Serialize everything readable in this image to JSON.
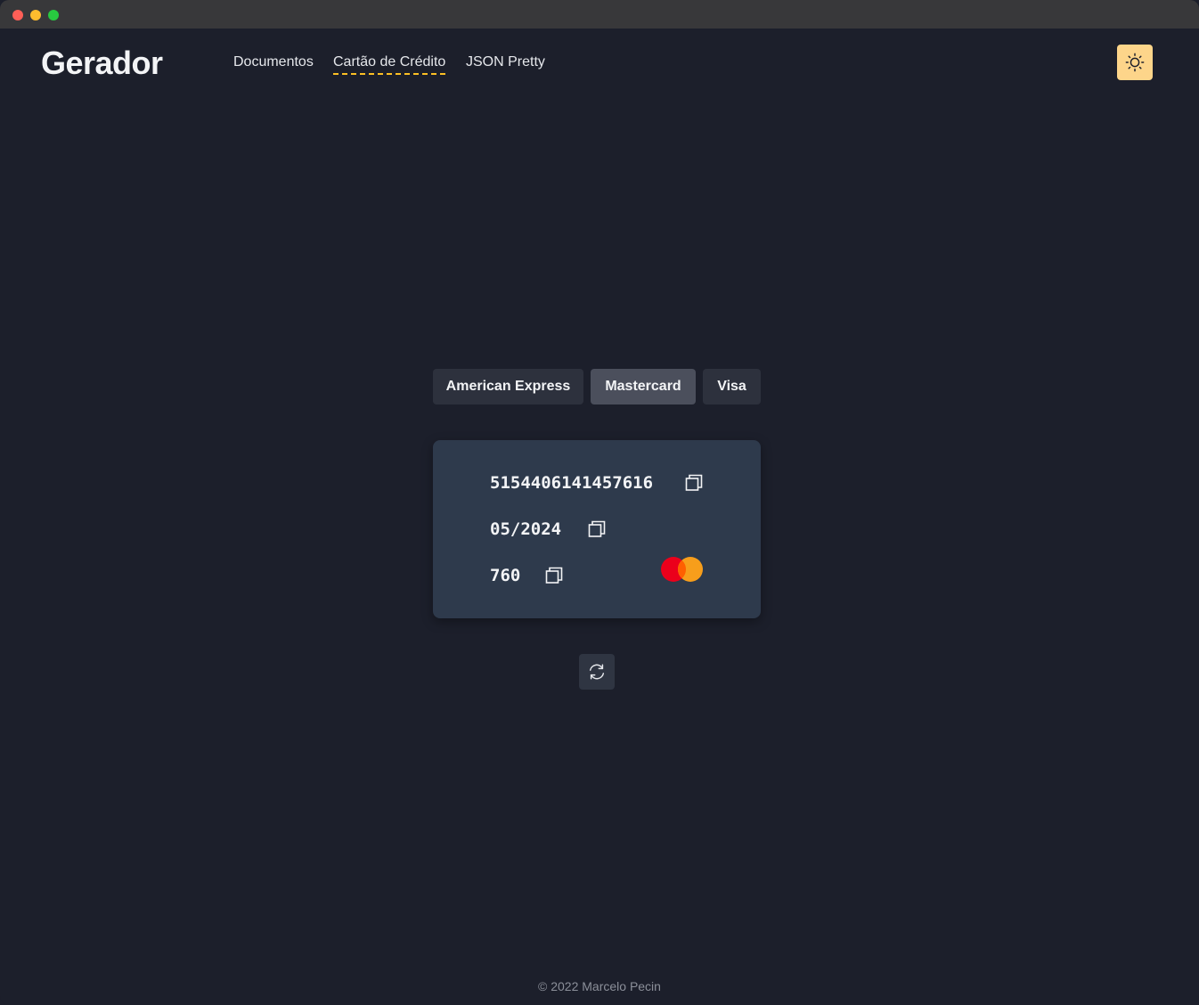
{
  "app": {
    "logo": "Gerador"
  },
  "nav": {
    "items": [
      {
        "label": "Documentos",
        "active": false
      },
      {
        "label": "Cartão de Crédito",
        "active": true
      },
      {
        "label": "JSON Pretty",
        "active": false
      }
    ],
    "theme_toggle_icon": "sun-icon"
  },
  "brands": {
    "options": [
      "American Express",
      "Mastercard",
      "Visa"
    ],
    "selected": "Mastercard"
  },
  "card": {
    "number": "5154406141457616",
    "expiry": "05/2024",
    "cvv": "760",
    "brand_logo": "mastercard-logo",
    "copy_icon": "copy-icon"
  },
  "actions": {
    "refresh_icon": "refresh-icon"
  },
  "footer": {
    "text": "© 2022 Marcelo Pecin"
  },
  "colors": {
    "background": "#1c1f2b",
    "card_background": "#2e3a4c",
    "accent": "#fbbf24",
    "theme_button": "#fdd58a",
    "mastercard_red": "#eb001b",
    "mastercard_orange": "#f79e1b"
  }
}
